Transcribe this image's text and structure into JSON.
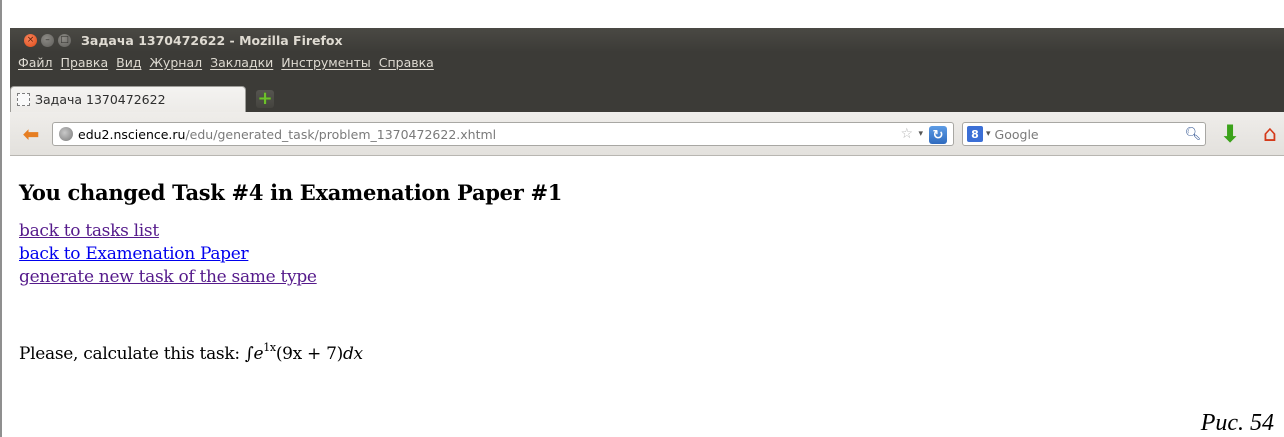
{
  "window": {
    "title": "Задача 1370472622 - Mozilla Firefox"
  },
  "menu": [
    "Файл",
    "Правка",
    "Вид",
    "Журнал",
    "Закладки",
    "Инструменты",
    "Справка"
  ],
  "tab": {
    "label": "Задача 1370472622"
  },
  "urlbar": {
    "host": "edu2.nscience.ru",
    "path": "/edu/generated_task/problem_1370472622.xhtml"
  },
  "search": {
    "engine_label": "8",
    "placeholder": "Google"
  },
  "page": {
    "heading": "You changed Task #4 in Examenation Paper #1",
    "links": [
      {
        "label": "back to tasks list",
        "state": "visited"
      },
      {
        "label": "back to Examenation Paper",
        "state": "unvisited"
      },
      {
        "label": "generate new task of the same type",
        "state": "visited"
      }
    ],
    "task_prefix": "Please, calculate this task: ",
    "task_formula": {
      "integral": "∫",
      "base": "e",
      "exponent": "1x",
      "body": "(9x + 7)",
      "differential": "dx"
    }
  },
  "caption": "Рис. 54",
  "colors": {
    "titlebar": "#3c3b37",
    "visited_link": "#551a8b",
    "unvisited_link": "#0000ee",
    "close_button": "#df4a16"
  },
  "icons": [
    "close-icon",
    "minimize-icon",
    "maximize-icon",
    "new-tab-icon",
    "back-arrow-icon",
    "globe-icon",
    "bookmark-star-icon",
    "reload-icon",
    "google-icon",
    "search-icon",
    "download-icon",
    "home-icon"
  ]
}
